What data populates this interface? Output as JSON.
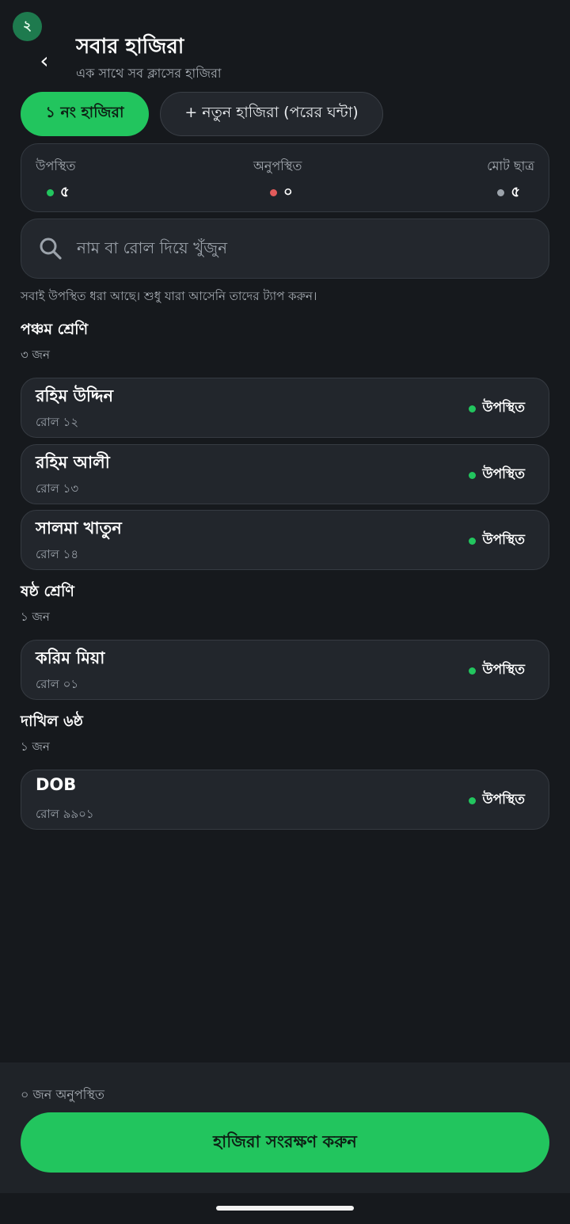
{
  "status_badge": "২",
  "header": {
    "back_icon": "‹",
    "title": "সবার হাজিরা",
    "subtitle": "এক সাথে সব ক্লাসের হাজিরা"
  },
  "tabs": {
    "active_label": "১ নং হাজিরা",
    "new_label": "+ নতুন হাজিরা (পরের ঘন্টা)"
  },
  "stats": {
    "present_label": "উপস্থিত",
    "present_value": "৫",
    "absent_label": "অনুপস্থিত",
    "absent_value": "০",
    "total_label": "মোট ছাত্র",
    "total_value": "৫",
    "colors": {
      "present": "#22c55e",
      "absent": "#e25b5b",
      "total": "#9ca3ab"
    }
  },
  "search": {
    "icon": "search-icon",
    "placeholder": "নাম বা রোল দিয়ে খুঁজুন"
  },
  "hint": "সবাই উপস্থিত ধরা আছে। শুধু যারা আসেনি তাদের ট্যাপ করুন।",
  "groups": [
    {
      "title": "পঞ্চম শ্রেণি",
      "count": "৩ জন",
      "students": [
        {
          "name": "রহিম উদ্দিন",
          "roll": "রোল ১২",
          "status": "উপস্থিত"
        },
        {
          "name": "রহিম আলী",
          "roll": "রোল ১৩",
          "status": "উপস্থিত"
        },
        {
          "name": "সালমা খাতুন",
          "roll": "রোল ১৪",
          "status": "উপস্থিত"
        }
      ]
    },
    {
      "title": "ষষ্ঠ শ্রেণি",
      "count": "১ জন",
      "students": [
        {
          "name": "করিম মিয়া",
          "roll": "রোল ০১",
          "status": "উপস্থিত"
        }
      ]
    },
    {
      "title": "দাখিল ৬ষ্ঠ",
      "count": "১ জন",
      "students": [
        {
          "name": "DOB",
          "roll": "রোল ৯৯০১",
          "status": "উপস্থিত"
        }
      ]
    }
  ],
  "footer": {
    "absent_summary": "০ জন অনুপস্থিত",
    "save_label": "হাজিরা সংরক্ষণ করুন"
  },
  "accent_color": "#22c55e"
}
